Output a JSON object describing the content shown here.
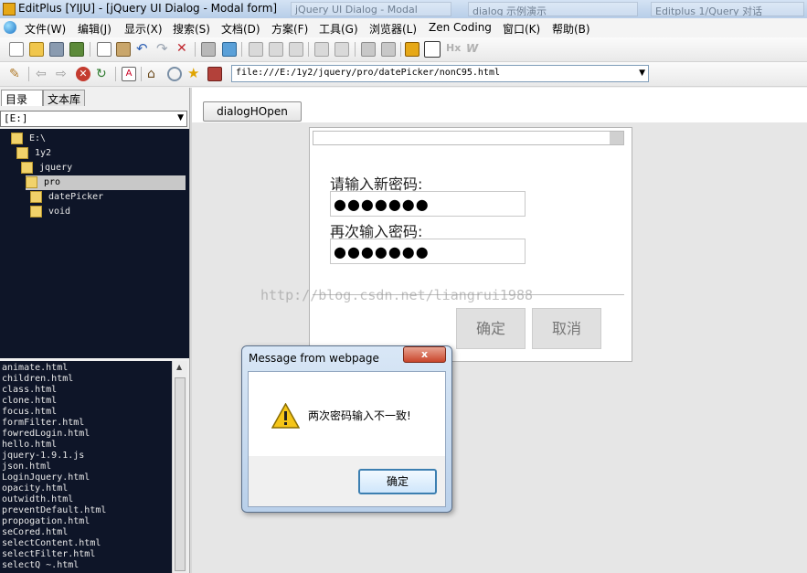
{
  "window": {
    "title": "EditPlus [YIJU] - [jQuery UI Dialog - Modal form]",
    "background_tabs": [
      "jQuery UI Dialog - Modal",
      "dialog 示例演示",
      "Editplus 1/Query 对话"
    ]
  },
  "menu": {
    "items": [
      "文件(W)",
      "编辑(J)",
      "显示(X)",
      "搜索(S)",
      "文档(D)",
      "方案(F)",
      "工具(G)",
      "浏览器(L)",
      "Zen Coding",
      "窗口(K)",
      "帮助(B)"
    ]
  },
  "address": {
    "url": "file:///E:/1y2/jquery/pro/datePicker/nonC95.html"
  },
  "left_panel": {
    "tabs": [
      "目录",
      "文本库"
    ],
    "drive": "[E:]",
    "tree": [
      "E:\\",
      "1y2",
      "jquery",
      "pro",
      "datePicker",
      "void"
    ],
    "files": [
      "animate.html",
      "children.html",
      "class.html",
      "clone.html",
      "focus.html",
      "formFilter.html",
      "fowredLogin.html",
      "hello.html",
      "jquery-1.9.1.js",
      "json.html",
      "LoginJquery.html",
      "opacity.html",
      "outwidth.html",
      "preventDefault.html",
      "propogation.html",
      "seCored.html",
      "selectContent.html",
      "selectFilter.html",
      "selectQ ~.html"
    ]
  },
  "page": {
    "open_button": "dialogHOpen",
    "label_new": "请输入新密码:",
    "label_repeat": "再次输入密码:",
    "value_new": "●●●●●●●",
    "value_repeat": "●●●●●●●",
    "confirm": "确定",
    "cancel": "取消",
    "watermark": "http://blog.csdn.net/liangrui1988"
  },
  "alert": {
    "title": "Message from webpage",
    "message": "两次密码输入不一致!",
    "ok": "确定",
    "close": "x"
  },
  "colors": {
    "tree_bg": "#0e1528",
    "alert_border": "#3c7fb1",
    "close_red": "#c9452b"
  }
}
